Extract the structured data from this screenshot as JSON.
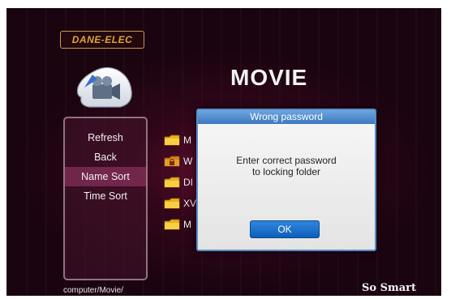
{
  "brand": {
    "logo_text": "DANE-ELEC",
    "slogan": "So Smart"
  },
  "page": {
    "title": "MOVIE"
  },
  "menu": {
    "items": [
      {
        "label": "Refresh"
      },
      {
        "label": "Back"
      },
      {
        "label": "Name Sort",
        "active": true
      },
      {
        "label": "Time Sort"
      }
    ]
  },
  "files": {
    "items": [
      {
        "name": "M",
        "icon": "folder-icon"
      },
      {
        "name": "W",
        "icon": "locked-folder-icon"
      },
      {
        "name": "DI",
        "icon": "folder-icon"
      },
      {
        "name": "XV",
        "icon": "folder-icon"
      },
      {
        "name": "M",
        "icon": "folder-icon"
      }
    ]
  },
  "dialog": {
    "title": "Wrong password",
    "message_line1": "Enter correct password",
    "message_line2": "to locking folder",
    "ok_label": "OK"
  },
  "status": {
    "path": "computer/Movie/"
  },
  "colors": {
    "dialog_title_bar": "#3d78c0",
    "ok_button": "#0d5fb8",
    "background": "#1a0410"
  }
}
